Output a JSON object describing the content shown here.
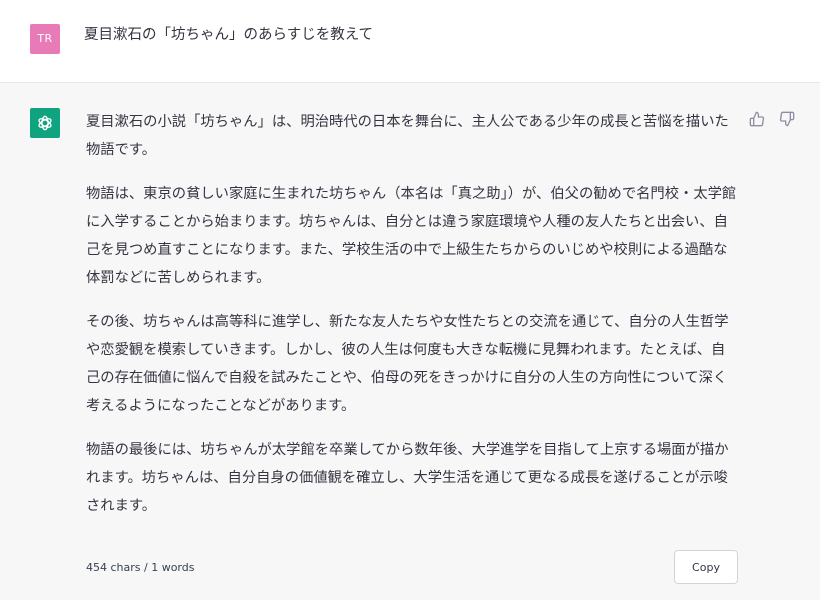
{
  "user_message": {
    "avatar_initials": "TR",
    "avatar_color": "#e87ab8",
    "text": "夏目漱石の「坊ちゃん」のあらすじを教えて"
  },
  "assistant_message": {
    "avatar_icon": "chatgpt-logo-icon",
    "avatar_color": "#10a37f",
    "paragraphs": [
      "夏目漱石の小説「坊ちゃん」は、明治時代の日本を舞台に、主人公である少年の成長と苦悩を描いた物語です。",
      "物語は、東京の貧しい家庭に生まれた坊ちゃん（本名は「真之助」）が、伯父の勧めで名門校・太学館に入学することから始まります。坊ちゃんは、自分とは違う家庭環境や人種の友人たちと出会い、自己を見つめ直すことになります。また、学校生活の中で上級生たちからのいじめや校則による過酷な体罰などに苦しめられます。",
      "その後、坊ちゃんは高等科に進学し、新たな友人たちや女性たちとの交流を通じて、自分の人生哲学や恋愛観を模索していきます。しかし、彼の人生は何度も大きな転機に見舞われます。たとえば、自己の存在価値に悩んで自殺を試みたことや、伯母の死をきっかけに自分の人生の方向性について深く考えるようになったことなどがあります。",
      "物語の最後には、坊ちゃんが太学館を卒業してから数年後、大学進学を目指して上京する場面が描かれます。坊ちゃんは、自分自身の価値観を確立し、大学生活を通じて更なる成長を遂げることが示唆されます。"
    ],
    "feedback_icons": [
      "thumbs-up-icon",
      "thumbs-down-icon"
    ],
    "stats": "454 chars / 1 words",
    "copy_label": "Copy"
  },
  "colors": {
    "user_bg": "#ffffff",
    "assistant_bg": "#f7f7f8",
    "text": "#343541"
  }
}
